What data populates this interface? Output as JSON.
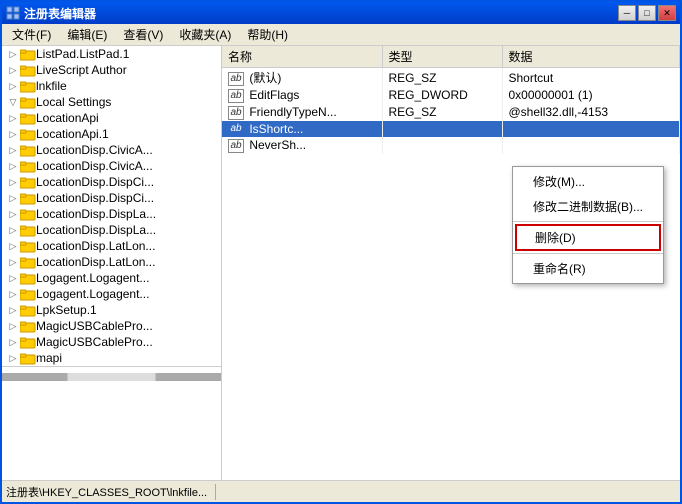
{
  "window": {
    "title": "注册表编辑器",
    "title_icon": "regedit"
  },
  "title_buttons": {
    "minimize": "─",
    "restore": "□",
    "close": "✕"
  },
  "menu": {
    "items": [
      {
        "label": "文件(F)"
      },
      {
        "label": "编辑(E)"
      },
      {
        "label": "查看(V)"
      },
      {
        "label": "收藏夹(A)"
      },
      {
        "label": "帮助(H)"
      }
    ]
  },
  "tree": {
    "items": [
      {
        "label": "ListPad.ListPad.1",
        "indent": 1,
        "expanded": false
      },
      {
        "label": "LiveScript Author",
        "indent": 1,
        "expanded": false
      },
      {
        "label": "lnkfile",
        "indent": 1,
        "expanded": false
      },
      {
        "label": "Local Settings",
        "indent": 1,
        "expanded": true,
        "selected": false
      },
      {
        "label": "LocationApi",
        "indent": 1,
        "expanded": false
      },
      {
        "label": "LocationApi.1",
        "indent": 1,
        "expanded": false
      },
      {
        "label": "LocationDisp.CivicA...",
        "indent": 1,
        "expanded": false
      },
      {
        "label": "LocationDisp.CivicA...",
        "indent": 1,
        "expanded": false
      },
      {
        "label": "LocationDisp.DispCi...",
        "indent": 1,
        "expanded": false
      },
      {
        "label": "LocationDisp.DispCi...",
        "indent": 1,
        "expanded": false
      },
      {
        "label": "LocationDisp.DispLa...",
        "indent": 1,
        "expanded": false
      },
      {
        "label": "LocationDisp.DispLa...",
        "indent": 1,
        "expanded": false
      },
      {
        "label": "LocationDisp.LatLon...",
        "indent": 1,
        "expanded": false
      },
      {
        "label": "LocationDisp.LatLon...",
        "indent": 1,
        "expanded": false
      },
      {
        "label": "Logagent.Logagent...",
        "indent": 1,
        "expanded": false
      },
      {
        "label": "Logagent.Logagent...",
        "indent": 1,
        "expanded": false
      },
      {
        "label": "LpkSetup.1",
        "indent": 1,
        "expanded": false
      },
      {
        "label": "MagicUSBCablePro...",
        "indent": 1,
        "expanded": false
      },
      {
        "label": "MagicUSBCablePro...",
        "indent": 1,
        "expanded": false
      },
      {
        "label": "mapi",
        "indent": 1,
        "expanded": false
      }
    ]
  },
  "registry_table": {
    "headers": [
      "名称",
      "类型",
      "数据"
    ],
    "rows": [
      {
        "name": "(默认)",
        "type": "REG_SZ",
        "data": "Shortcut",
        "icon": "ab"
      },
      {
        "name": "EditFlags",
        "type": "REG_DWORD",
        "data": "0x00000001 (1)",
        "icon": "ab"
      },
      {
        "name": "FriendlyTypeN...",
        "type": "REG_SZ",
        "data": "@shell32.dll,-4153",
        "icon": "ab"
      },
      {
        "name": "IsShortc...",
        "type": "",
        "data": "",
        "icon": "ab",
        "selected": true
      },
      {
        "name": "NeverSh...",
        "type": "",
        "data": "",
        "icon": "ab"
      }
    ]
  },
  "context_menu": {
    "items": [
      {
        "label": "修改(M)...",
        "highlighted": false
      },
      {
        "label": "修改二进制数据(B)...",
        "highlighted": false
      },
      {
        "label": "删除(D)",
        "highlighted": true
      },
      {
        "label": "重命名(R)",
        "highlighted": false
      }
    ]
  },
  "status_bar": {
    "text": "注册表\\HKEY_CLASSES_ROOT\\lnkfile..."
  }
}
